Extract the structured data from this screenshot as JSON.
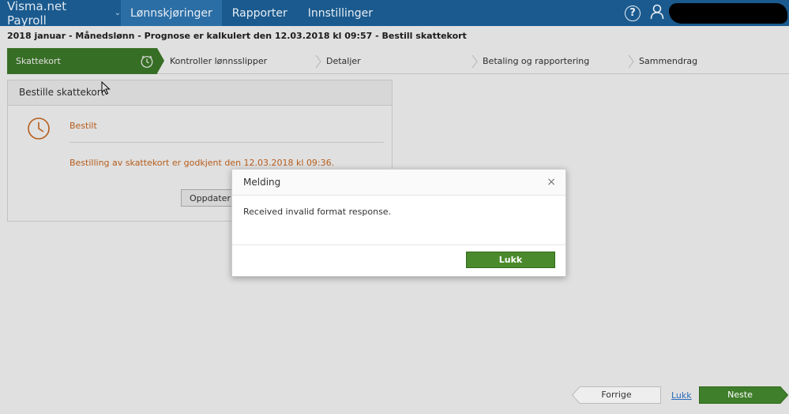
{
  "topbar": {
    "app_name": "Visma.net Payroll",
    "nav": [
      "Lønnskjøringer",
      "Rapporter",
      "Innstillinger"
    ],
    "active_nav": "Lønnskjøringer",
    "icons": [
      "chevron-down-icon",
      "help-icon",
      "user-icon"
    ],
    "colors": {
      "bar": "#1a5a8e",
      "active_tab": "#2b6ea6"
    }
  },
  "page_title": "2018 januar - Månedslønn - Prognose er kalkulert den 12.03.2018 kl 09:57 - Bestill skattekort",
  "stepper": {
    "steps": [
      "Skattekort",
      "Kontroller lønnsslipper",
      "Detaljer",
      "Betaling og rapportering",
      "Sammendrag"
    ],
    "active_index": 0,
    "active_color": "#3f7e2b"
  },
  "card": {
    "title": "Bestille skattekort",
    "status": "Bestilt",
    "message": "Bestilling av skattekort er godkjent den 12.03.2018 kl 09:36.",
    "update_button": "Oppdater s",
    "status_color": "#d06a20"
  },
  "modal": {
    "title": "Melding",
    "close_glyph": "×",
    "body": "Received invalid format response.",
    "button": "Lukk"
  },
  "bottom": {
    "prev": "Forrige",
    "close_link": "Lukk",
    "next": "Neste"
  }
}
